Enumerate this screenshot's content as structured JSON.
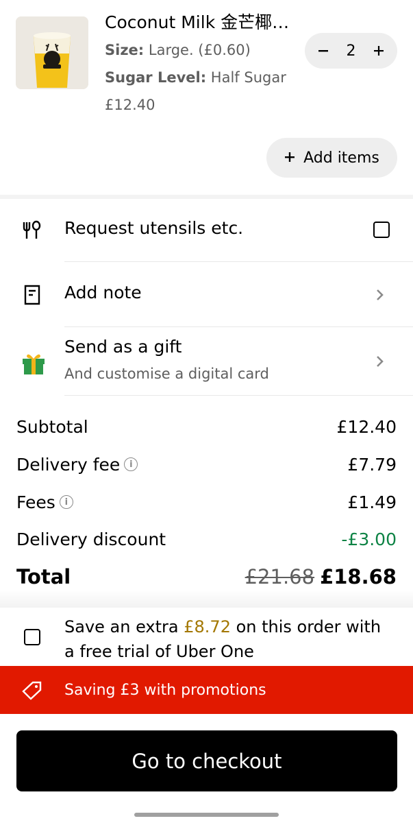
{
  "item": {
    "name": "Coconut Milk 金芒椰…",
    "size_label": "Size:",
    "size_value": "Large. (£0.60)",
    "sugar_label": "Sugar Level:",
    "sugar_value": "Half Sugar",
    "price": "£12.40",
    "quantity": "2",
    "icon_minus": "minus-icon",
    "icon_plus": "plus-icon"
  },
  "add_items": {
    "label": "Add items",
    "icon": "plus-icon"
  },
  "options": {
    "utensils": {
      "label": "Request utensils etc.",
      "icon": "utensils-icon",
      "checked": false
    },
    "note": {
      "label": "Add note",
      "icon": "note-icon"
    },
    "gift": {
      "label": "Send as a gift",
      "sublabel": "And customise a digital card",
      "icon": "gift-icon"
    }
  },
  "summary": {
    "subtotal_label": "Subtotal",
    "subtotal": "£12.40",
    "delivery_fee_label": "Delivery fee",
    "delivery_fee": "£7.79",
    "fees_label": "Fees",
    "fees": "£1.49",
    "discount_label": "Delivery discount",
    "discount": "-£3.00",
    "total_label": "Total",
    "total_original": "£21.68",
    "total": "£18.68",
    "info_glyph": "i"
  },
  "uber_one": {
    "text_before": "Save an extra ",
    "amount": "£8.72",
    "text_after": " on this order with a free trial of Uber One",
    "checked": false
  },
  "promotion": {
    "label": "Saving £3 with promotions",
    "icon": "tag-icon"
  },
  "checkout_button": "Go to checkout",
  "colors": {
    "promo_red": "#e11900",
    "discount_green": "#0e8345",
    "uber_one_gold": "#a37700",
    "checkout_black": "#000000"
  }
}
